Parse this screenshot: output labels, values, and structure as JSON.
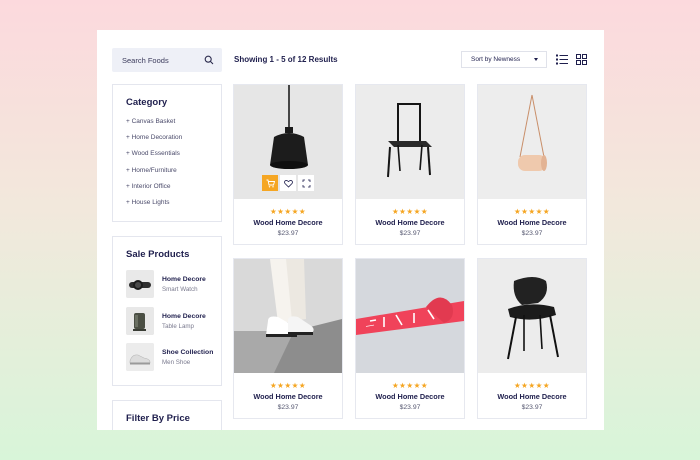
{
  "search": {
    "label": "Search Foods"
  },
  "toolbar": {
    "showing": "Showing 1 - 5 of 12  Results",
    "sort_label": "Sort by Newness"
  },
  "category": {
    "title": "Category",
    "items": [
      "+ Canvas Basket",
      "+ Home Decoration",
      "+ Wood Essentials",
      "+ Home/Furniture",
      "+ Interior Office",
      "+ House Lights"
    ]
  },
  "sale": {
    "title": "Sale Products",
    "items": [
      {
        "name": "Home Decore",
        "sub": "Smart Watch"
      },
      {
        "name": "Home Decore",
        "sub": "Table Lamp"
      },
      {
        "name": "Shoe Collection",
        "sub": "Men Shoe"
      }
    ]
  },
  "filter": {
    "title": "Filter By Price"
  },
  "products": [
    {
      "name": "Wood Home Decore",
      "price": "$23.97",
      "stars": "★★★★★"
    },
    {
      "name": "Wood Home Decore",
      "price": "$23.97",
      "stars": "★★★★★"
    },
    {
      "name": "Wood Home Decore",
      "price": "$23.97",
      "stars": "★★★★★"
    },
    {
      "name": "Wood Home Decore",
      "price": "$23.97",
      "stars": "★★★★★"
    },
    {
      "name": "Wood Home Decore",
      "price": "$23.97",
      "stars": "★★★★★"
    },
    {
      "name": "Wood Home Decore",
      "price": "$23.97",
      "stars": "★★★★★"
    }
  ],
  "colors": {
    "accent": "#f5a623",
    "text_dark": "#1f1f4d",
    "tape_red": "#f0435a"
  }
}
